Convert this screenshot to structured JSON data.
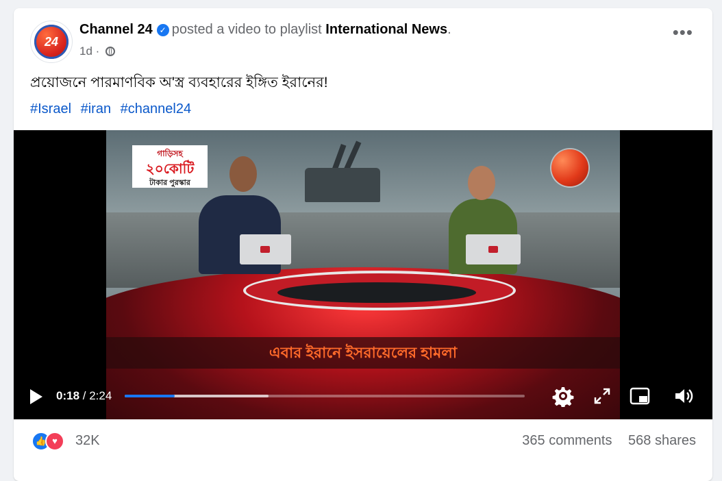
{
  "post": {
    "page_name": "Channel 24",
    "action_text": "posted a video to playlist",
    "playlist": "International News",
    "playlist_suffix": ".",
    "time_ago": "1d",
    "time_sep": "·",
    "more_icon": "more-horizontal-icon",
    "text": "প্রয়োজনে পারমাণবিক অ'স্ত্র ব্যবহারের ইঙ্গিত ইরানের!",
    "hashtags": [
      "#Israel",
      "#iran",
      "#channel24"
    ]
  },
  "avatar": {
    "text": "24"
  },
  "video": {
    "ad_line1": "গাড়িসহ",
    "ad_line2": "২০কোটি",
    "ad_line3": "টাকার পুরস্কার",
    "caption": "এবার ইরানে ইসরায়েলের হামলা",
    "current_time": "0:18",
    "total_time": "/ 2:24",
    "played_fraction": 0.125,
    "buffered_fraction": 0.36
  },
  "footer": {
    "reaction_count": "32K",
    "comments": "365 comments",
    "shares": "568 shares"
  },
  "colors": {
    "accent": "#1877f2",
    "love": "#f33e58",
    "caption": "#ff6a2a"
  }
}
